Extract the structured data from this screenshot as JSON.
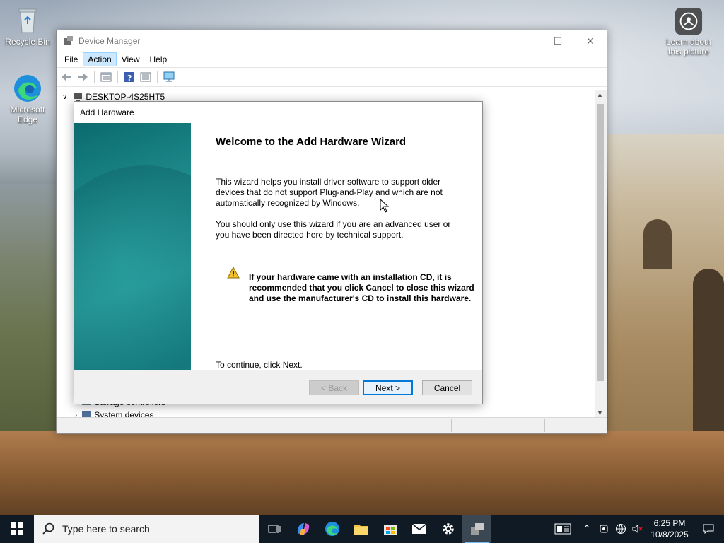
{
  "desktop": {
    "icons": [
      {
        "label": "Recycle Bin"
      },
      {
        "label": "Microsoft Edge"
      },
      {
        "label": "Learn about this picture"
      }
    ]
  },
  "window": {
    "title": "Device Manager",
    "menu": [
      "File",
      "Action",
      "View",
      "Help"
    ],
    "active_menu": "Action",
    "tree": {
      "root": "DESKTOP-4S25HT5",
      "partial_items": [
        "Storage controllers",
        "System devices"
      ]
    }
  },
  "dialog": {
    "title": "Add Hardware",
    "heading": "Welcome to the Add Hardware Wizard",
    "para1": "This wizard helps you install driver software to support older devices that do not support Plug-and-Play and which are not automatically recognized by Windows.",
    "para2": "You should only use this wizard if you are an advanced user or you have been directed here by technical support.",
    "warning": "If your hardware came with an installation CD, it is recommended that you click Cancel to close this wizard and use the manufacturer's CD to install this hardware.",
    "continue": "To continue, click Next.",
    "buttons": {
      "back": "< Back",
      "next": "Next >",
      "cancel": "Cancel"
    }
  },
  "taskbar": {
    "search_placeholder": "Type here to search",
    "time": "6:25 PM",
    "date": "10/8/2025"
  },
  "colors": {
    "taskbar": "#0f1a24",
    "accent": "#0078d7",
    "wizard_panel": "#1f8c8d"
  }
}
